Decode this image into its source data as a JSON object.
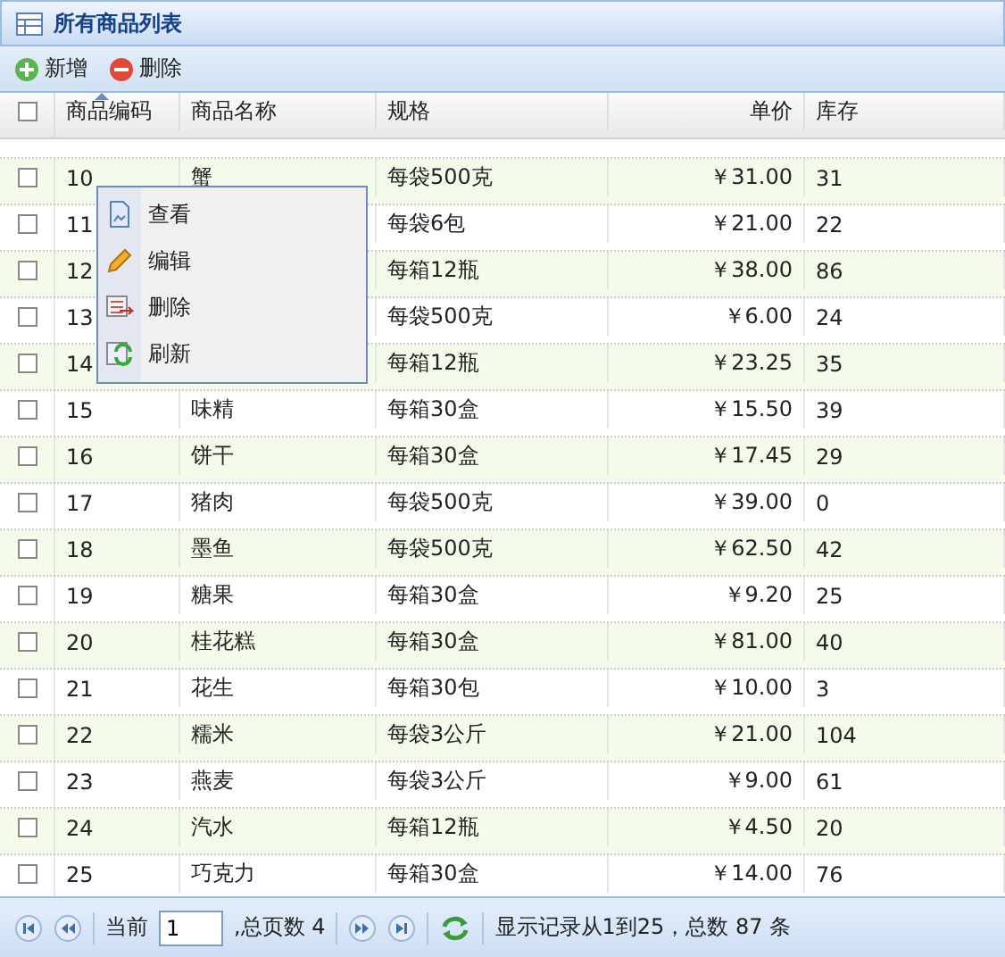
{
  "panel": {
    "title": "所有商品列表"
  },
  "toolbar": [
    {
      "kind": "add",
      "label": "新增"
    },
    {
      "kind": "remove",
      "label": "删除"
    }
  ],
  "table": {
    "all_checked": false,
    "columns": [
      {
        "label": "商品编码",
        "sorted": true
      },
      {
        "label": "商品名称",
        "sorted": false
      },
      {
        "label": "规格",
        "sorted": false
      },
      {
        "label": "单价",
        "sorted": false
      },
      {
        "label": "库存",
        "sorted": false
      }
    ],
    "rows": [
      {
        "checked": false,
        "code": "10",
        "name": "蟹",
        "spec": "每袋500克",
        "price": "￥31.00",
        "stock": "31"
      },
      {
        "checked": false,
        "code": "11",
        "spec": "每袋6包",
        "price": "￥21.00",
        "stock": "22"
      },
      {
        "checked": false,
        "code": "12",
        "spec": "每箱12瓶",
        "price": "￥38.00",
        "stock": "86"
      },
      {
        "checked": false,
        "code": "13",
        "spec": "每袋500克",
        "price": "￥6.00",
        "stock": "24"
      },
      {
        "checked": false,
        "code": "14",
        "spec": "每箱12瓶",
        "price": "￥23.25",
        "stock": "35"
      },
      {
        "checked": false,
        "code": "15",
        "name": "味精",
        "spec": "每箱30盒",
        "price": "￥15.50",
        "stock": "39"
      },
      {
        "checked": false,
        "code": "16",
        "name": "饼干",
        "spec": "每箱30盒",
        "price": "￥17.45",
        "stock": "29"
      },
      {
        "checked": false,
        "code": "17",
        "name": "猪肉",
        "spec": "每袋500克",
        "price": "￥39.00",
        "stock": "0"
      },
      {
        "checked": false,
        "code": "18",
        "name": "墨鱼",
        "spec": "每袋500克",
        "price": "￥62.50",
        "stock": "42"
      },
      {
        "checked": false,
        "code": "19",
        "name": "糖果",
        "spec": "每箱30盒",
        "price": "￥9.20",
        "stock": "25"
      },
      {
        "checked": false,
        "code": "20",
        "name": "桂花糕",
        "spec": "每箱30盒",
        "price": "￥81.00",
        "stock": "40"
      },
      {
        "checked": false,
        "code": "21",
        "name": "花生",
        "spec": "每箱30包",
        "price": "￥10.00",
        "stock": "3"
      },
      {
        "checked": false,
        "code": "22",
        "name": "糯米",
        "spec": "每袋3公斤",
        "price": "￥21.00",
        "stock": "104"
      },
      {
        "checked": false,
        "code": "23",
        "name": "燕麦",
        "spec": "每袋3公斤",
        "price": "￥9.00",
        "stock": "61"
      },
      {
        "checked": false,
        "code": "24",
        "name": "汽水",
        "spec": "每箱12瓶",
        "price": "￥4.50",
        "stock": "20"
      },
      {
        "checked": false,
        "code": "25",
        "name": "巧克力",
        "spec": "每箱30盒",
        "price": "￥14.00",
        "stock": "76"
      }
    ]
  },
  "context_menu": [
    {
      "kind": "view",
      "label": "查看"
    },
    {
      "kind": "edit",
      "label": "编辑"
    },
    {
      "kind": "delete",
      "label": "删除"
    },
    {
      "kind": "refresh",
      "label": "刷新"
    }
  ],
  "pager": {
    "current_label": "当前",
    "page": "1",
    "total_label": ",总页数 4",
    "info": "显示记录从1到25，总数 87 条"
  }
}
